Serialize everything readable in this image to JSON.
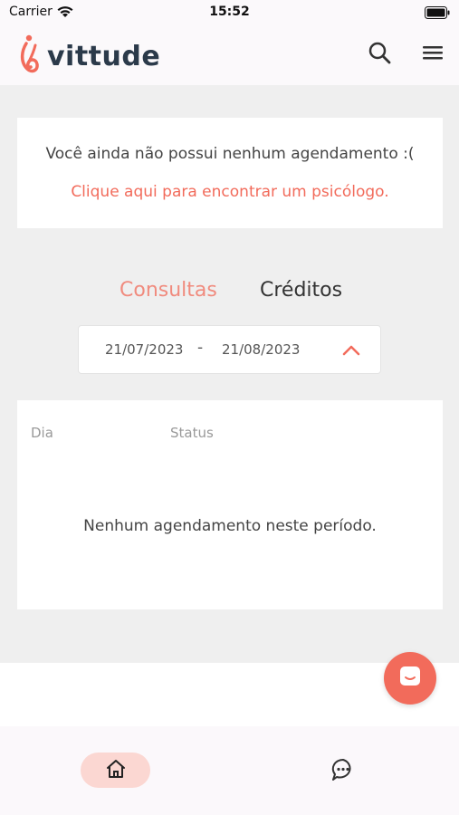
{
  "status_bar": {
    "carrier": "Carrier",
    "time": "15:52",
    "wifi_icon": "wifi-icon",
    "battery_icon": "battery-icon"
  },
  "header": {
    "logo_text": "vittude",
    "logo_icon": "vittude-logo-icon",
    "search_icon": "search-icon",
    "menu_icon": "hamburger-menu-icon"
  },
  "notice": {
    "message": "Você ainda não possui nenhum agendamento :(",
    "link_text": "Clique aqui para encontrar um psicólogo."
  },
  "tabs": [
    {
      "label": "Consultas",
      "active": true
    },
    {
      "label": "Créditos",
      "active": false
    }
  ],
  "date_range": {
    "start": "21/07/2023",
    "separator": "-",
    "end": "21/08/2023",
    "toggle_icon": "chevron-up-icon"
  },
  "table": {
    "columns": [
      "Dia",
      "Status"
    ],
    "empty_message": "Nenhum agendamento neste período."
  },
  "chat_fab": {
    "icon": "chat-bubble-icon"
  },
  "bottom_nav": {
    "items": [
      {
        "icon": "home-icon",
        "active": true
      },
      {
        "icon": "message-dots-icon",
        "active": false
      }
    ]
  },
  "colors": {
    "accent": "#f26b5b",
    "accent_light": "#fbd7d2",
    "tab_active": "#f08b7e",
    "logo_text": "#2b3a4a",
    "background": "#efefef"
  }
}
